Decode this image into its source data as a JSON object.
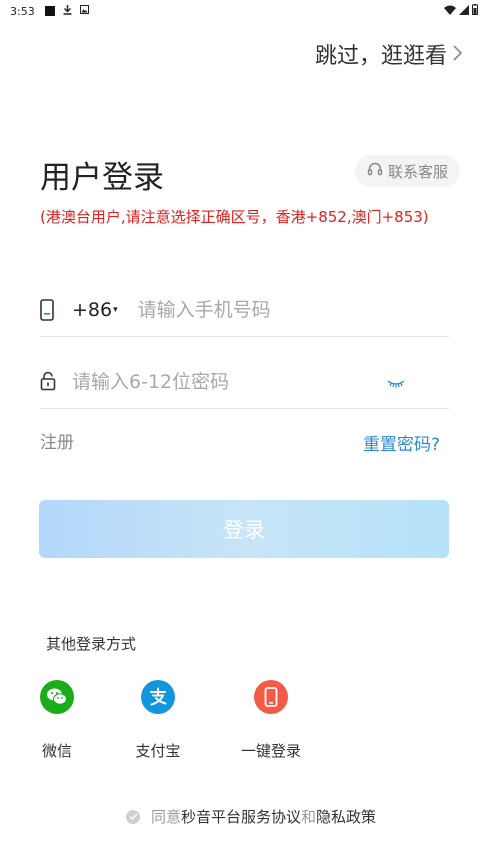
{
  "status_bar": {
    "time": "3:53"
  },
  "header": {
    "skip_label": "跳过，逛逛看"
  },
  "login": {
    "title": "用户登录",
    "service_label": "联系客服",
    "notice": "(港澳台用户,请注意选择正确区号，香港+852,澳门+853)",
    "country_code": "+86",
    "phone_placeholder": "请输入手机号码",
    "password_placeholder": "请输入6-12位密码",
    "register_label": "注册",
    "reset_label": "重置密码?",
    "submit_label": "登录"
  },
  "other_login": {
    "label": "其他登录方式",
    "options": [
      {
        "label": "微信",
        "color": "#1aad19"
      },
      {
        "label": "支付宝",
        "color": "#1296db"
      },
      {
        "label": "一键登录",
        "color": "#f25b45"
      }
    ]
  },
  "agreement": {
    "prefix": "同意",
    "service_link": "秒音平台服务协议",
    "and": "和",
    "privacy_link": "隐私政策"
  }
}
